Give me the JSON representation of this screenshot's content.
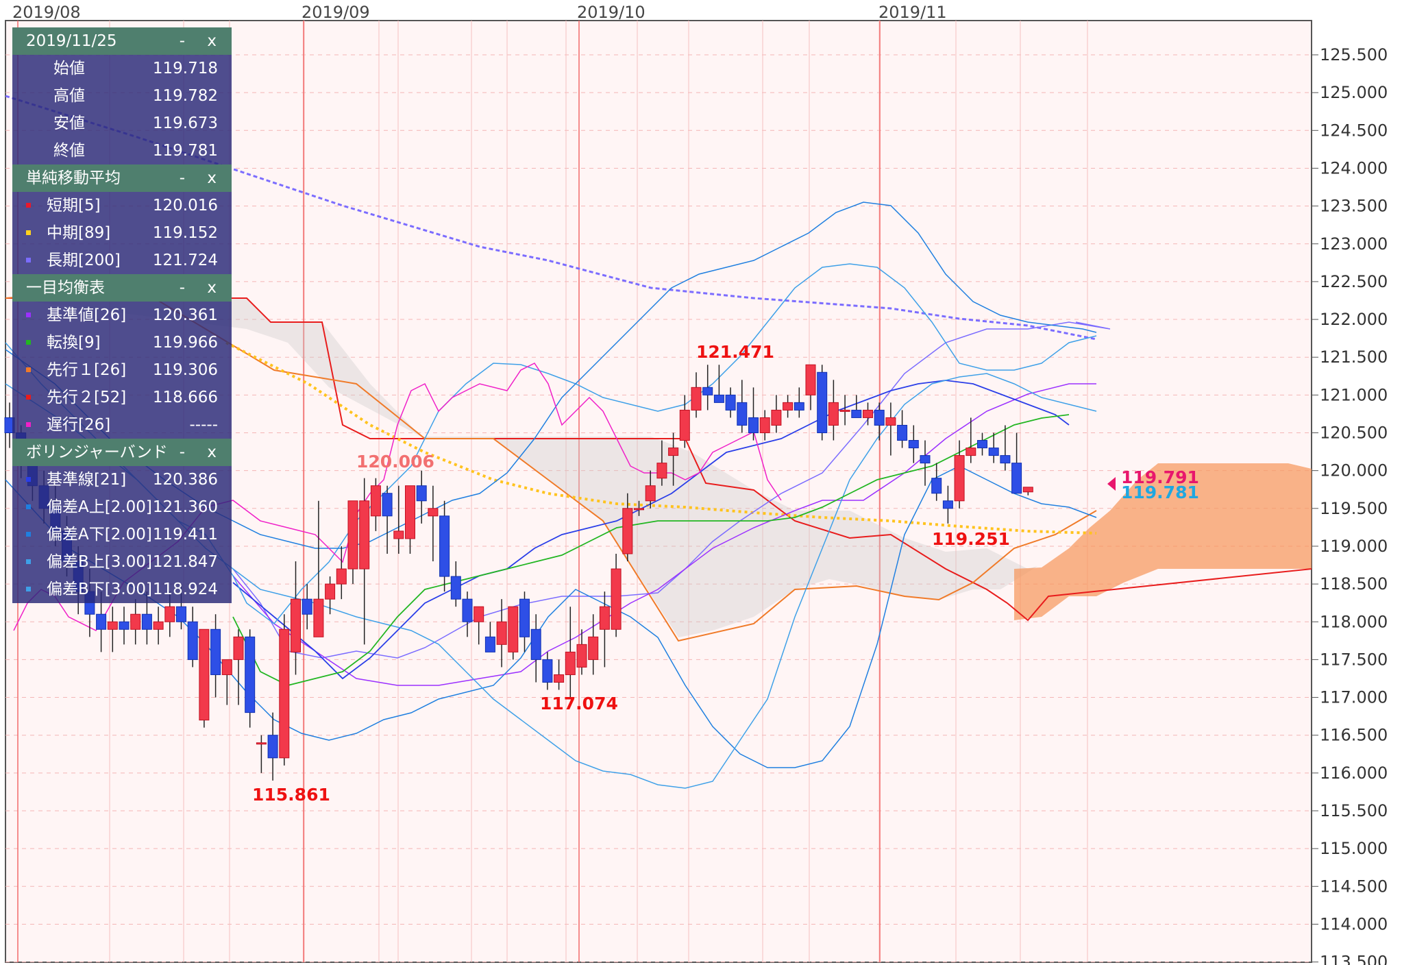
{
  "chart_data": {
    "type": "candlestick",
    "x_tick_labels": [
      "2019/08",
      "2019/09",
      "2019/10",
      "2019/11"
    ],
    "y_tick_labels": [
      "125.500",
      "125.000",
      "124.500",
      "124.000",
      "123.500",
      "123.000",
      "122.500",
      "122.000",
      "121.500",
      "121.000",
      "120.500",
      "120.000",
      "119.500",
      "119.000",
      "118.500",
      "118.000",
      "117.500",
      "117.000",
      "116.500",
      "116.000",
      "115.500",
      "115.000",
      "114.500",
      "114.000",
      "113.500"
    ],
    "ylim": [
      113.5,
      125.9
    ],
    "grid": true,
    "annotations": [
      {
        "text": "121.471",
        "x": "2019/10",
        "y": 121.471
      },
      {
        "text": "120.006",
        "x": "2019/09",
        "y": 120.006
      },
      {
        "text": "117.074",
        "x": "2019/10",
        "y": 117.074
      },
      {
        "text": "115.861",
        "x": "2019/09",
        "y": 115.861
      },
      {
        "text": "119.251",
        "x": "2019/11",
        "y": 119.251
      }
    ],
    "price_tags": [
      {
        "text": "119.791",
        "color": "#e8166c",
        "y": 119.791
      },
      {
        "text": "119.781",
        "color": "#1fa7e0",
        "y": 119.781
      }
    ],
    "candles": [
      [
        120.7,
        120.9,
        120.3,
        120.5
      ],
      [
        120.5,
        120.6,
        119.9,
        120.1
      ],
      [
        120.1,
        120.3,
        119.6,
        119.8
      ],
      [
        119.8,
        120.0,
        119.3,
        119.5
      ],
      [
        119.5,
        119.8,
        119.0,
        119.2
      ],
      [
        119.2,
        119.4,
        118.6,
        118.8
      ],
      [
        118.8,
        119.0,
        118.1,
        118.4
      ],
      [
        118.4,
        118.7,
        117.8,
        118.1
      ],
      [
        118.1,
        118.4,
        117.6,
        117.9
      ],
      [
        117.9,
        118.2,
        117.6,
        118.0
      ],
      [
        118.0,
        118.2,
        117.7,
        117.9
      ],
      [
        117.9,
        118.3,
        117.7,
        118.1
      ],
      [
        118.1,
        118.4,
        117.7,
        117.9
      ],
      [
        117.9,
        118.2,
        117.7,
        118.0
      ],
      [
        118.0,
        118.4,
        117.8,
        118.2
      ],
      [
        118.2,
        118.5,
        117.9,
        118.0
      ],
      [
        118.0,
        118.2,
        117.4,
        117.5
      ],
      [
        116.7,
        117.9,
        116.6,
        117.9
      ],
      [
        117.9,
        118.1,
        117.0,
        117.3
      ],
      [
        117.3,
        117.5,
        116.9,
        117.5
      ],
      [
        117.5,
        117.9,
        116.9,
        117.8
      ],
      [
        117.8,
        117.9,
        116.6,
        116.8
      ],
      [
        116.4,
        116.5,
        116.0,
        116.4
      ],
      [
        116.5,
        116.8,
        115.9,
        116.2
      ],
      [
        116.2,
        118.1,
        116.1,
        117.9
      ],
      [
        117.6,
        118.8,
        117.3,
        118.3
      ],
      [
        118.3,
        118.5,
        117.9,
        118.1
      ],
      [
        117.8,
        119.6,
        117.8,
        118.3
      ],
      [
        118.3,
        118.6,
        118.1,
        118.5
      ],
      [
        118.5,
        119.0,
        118.3,
        118.7
      ],
      [
        118.7,
        119.6,
        118.5,
        119.6
      ],
      [
        118.7,
        119.9,
        117.7,
        119.6
      ],
      [
        119.4,
        119.9,
        119.2,
        119.8
      ],
      [
        119.7,
        119.8,
        118.9,
        119.4
      ],
      [
        119.1,
        119.8,
        118.9,
        119.2
      ],
      [
        119.1,
        119.8,
        118.9,
        119.8
      ],
      [
        119.8,
        120.0,
        119.3,
        119.6
      ],
      [
        119.4,
        119.8,
        118.8,
        119.5
      ],
      [
        119.4,
        119.6,
        118.4,
        118.6
      ],
      [
        118.6,
        118.8,
        118.2,
        118.3
      ],
      [
        118.3,
        118.4,
        117.8,
        118.0
      ],
      [
        118.0,
        118.2,
        117.7,
        118.2
      ],
      [
        117.8,
        118.0,
        117.6,
        117.6
      ],
      [
        117.7,
        118.3,
        117.4,
        118.0
      ],
      [
        117.6,
        118.1,
        117.5,
        118.2
      ],
      [
        118.3,
        118.4,
        117.6,
        117.8
      ],
      [
        117.9,
        118.1,
        117.2,
        117.5
      ],
      [
        117.5,
        117.6,
        117.1,
        117.2
      ],
      [
        117.2,
        117.5,
        117.1,
        117.3
      ],
      [
        117.3,
        118.2,
        117.0,
        117.6
      ],
      [
        117.4,
        117.9,
        117.3,
        117.7
      ],
      [
        117.5,
        118.1,
        117.3,
        117.8
      ],
      [
        117.9,
        118.4,
        117.4,
        118.2
      ],
      [
        117.9,
        118.9,
        117.8,
        118.7
      ],
      [
        118.9,
        119.7,
        118.8,
        119.5
      ],
      [
        119.5,
        119.6,
        119.4,
        119.5
      ],
      [
        119.6,
        120.0,
        119.5,
        119.8
      ],
      [
        119.9,
        120.4,
        119.8,
        120.1
      ],
      [
        120.2,
        120.5,
        119.8,
        120.3
      ],
      [
        120.4,
        121.0,
        120.3,
        120.8
      ],
      [
        120.8,
        121.3,
        120.7,
        121.1
      ],
      [
        121.1,
        121.4,
        120.8,
        121.0
      ],
      [
        121.0,
        121.4,
        120.9,
        120.9
      ],
      [
        121.0,
        121.1,
        120.7,
        120.8
      ],
      [
        120.9,
        121.2,
        120.5,
        120.6
      ],
      [
        120.7,
        121.1,
        120.4,
        120.5
      ],
      [
        120.5,
        120.8,
        120.4,
        120.7
      ],
      [
        120.6,
        121.0,
        120.5,
        120.8
      ],
      [
        120.8,
        121.0,
        120.7,
        120.9
      ],
      [
        120.9,
        121.1,
        120.7,
        120.8
      ],
      [
        121.0,
        121.4,
        120.8,
        121.4
      ],
      [
        121.3,
        121.4,
        120.4,
        120.5
      ],
      [
        120.6,
        121.2,
        120.4,
        120.9
      ],
      [
        120.8,
        121.0,
        120.6,
        120.8
      ],
      [
        120.8,
        121.0,
        120.7,
        120.7
      ],
      [
        120.7,
        120.9,
        120.6,
        120.8
      ],
      [
        120.8,
        120.9,
        120.4,
        120.6
      ],
      [
        120.6,
        120.9,
        120.2,
        120.7
      ],
      [
        120.6,
        120.8,
        120.3,
        120.4
      ],
      [
        120.4,
        120.6,
        120.1,
        120.3
      ],
      [
        120.2,
        120.4,
        119.8,
        120.1
      ],
      [
        119.9,
        120.1,
        119.6,
        119.7
      ],
      [
        119.6,
        119.8,
        119.3,
        119.5
      ],
      [
        119.6,
        120.4,
        119.5,
        120.2
      ],
      [
        120.2,
        120.7,
        120.1,
        120.3
      ],
      [
        120.4,
        120.5,
        120.2,
        120.3
      ],
      [
        120.3,
        120.5,
        120.1,
        120.2
      ],
      [
        120.2,
        120.6,
        120.0,
        120.1
      ],
      [
        120.1,
        120.5,
        119.7,
        119.7
      ],
      [
        119.718,
        119.782,
        119.673,
        119.781
      ]
    ]
  },
  "panel": {
    "date": "2019/11/25",
    "minimize": "-",
    "close": "x",
    "ohlc": [
      {
        "label": "始値",
        "value": "119.718"
      },
      {
        "label": "高値",
        "value": "119.782"
      },
      {
        "label": "安値",
        "value": "119.673"
      },
      {
        "label": "終値",
        "value": "119.781"
      }
    ],
    "sma": {
      "title": "単純移動平均",
      "items": [
        {
          "label": "短期[5]",
          "value": "120.016",
          "color": "#e8192c"
        },
        {
          "label": "中期[89]",
          "value": "119.152",
          "color": "#ffd21e"
        },
        {
          "label": "長期[200]",
          "value": "121.724",
          "color": "#7b6cff"
        }
      ]
    },
    "ichimoku": {
      "title": "一目均衡表",
      "items": [
        {
          "label": "基準値[26]",
          "value": "120.361",
          "color": "#9b30ff"
        },
        {
          "label": "転換[9]",
          "value": "119.966",
          "color": "#22b622"
        },
        {
          "label": "先行１[26]",
          "value": "119.306",
          "color": "#f07a28"
        },
        {
          "label": "先行２[52]",
          "value": "118.666",
          "color": "#e81c1c"
        },
        {
          "label": "遅行[26]",
          "value": "-----",
          "color": "#f020c8"
        }
      ]
    },
    "bollinger": {
      "title": "ボリンジャーバンド",
      "items": [
        {
          "label": "基準線[21]",
          "value": "120.386",
          "color": "#2a3ee8"
        },
        {
          "label": "偏差A上[2.00]",
          "value": "121.360",
          "color": "#1f7fe0"
        },
        {
          "label": "偏差A下[2.00]",
          "value": "119.411",
          "color": "#1f7fe0"
        },
        {
          "label": "偏差B上[3.00]",
          "value": "121.847",
          "color": "#3ea0e8"
        },
        {
          "label": "偏差B下[3.00]",
          "value": "118.924",
          "color": "#3ea0e8"
        }
      ]
    }
  }
}
